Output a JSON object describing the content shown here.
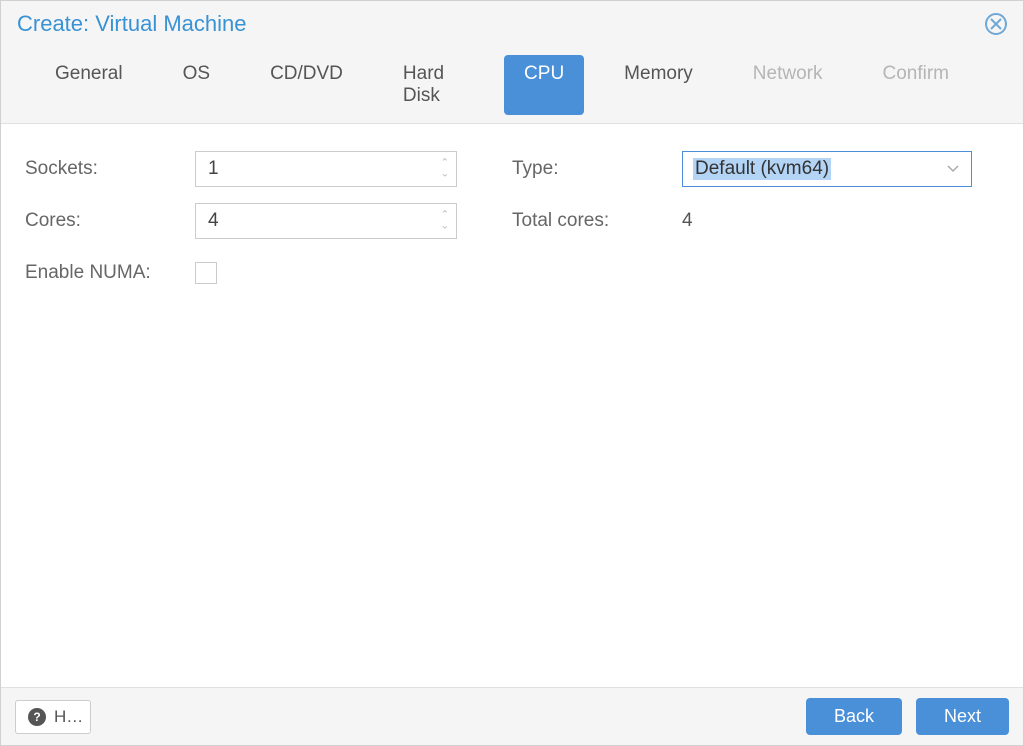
{
  "dialog": {
    "title": "Create: Virtual Machine"
  },
  "tabs": {
    "general": "General",
    "os": "OS",
    "cddvd": "CD/DVD",
    "harddisk": "Hard Disk",
    "cpu": "CPU",
    "memory": "Memory",
    "network": "Network",
    "confirm": "Confirm"
  },
  "fields": {
    "sockets": {
      "label": "Sockets:",
      "value": "1"
    },
    "cores": {
      "label": "Cores:",
      "value": "4"
    },
    "numa": {
      "label": "Enable NUMA:",
      "checked": false
    },
    "type": {
      "label": "Type:",
      "value": "Default (kvm64)"
    },
    "totalcores": {
      "label": "Total cores:",
      "value": "4"
    }
  },
  "footer": {
    "help": "H…",
    "back": "Back",
    "next": "Next"
  }
}
